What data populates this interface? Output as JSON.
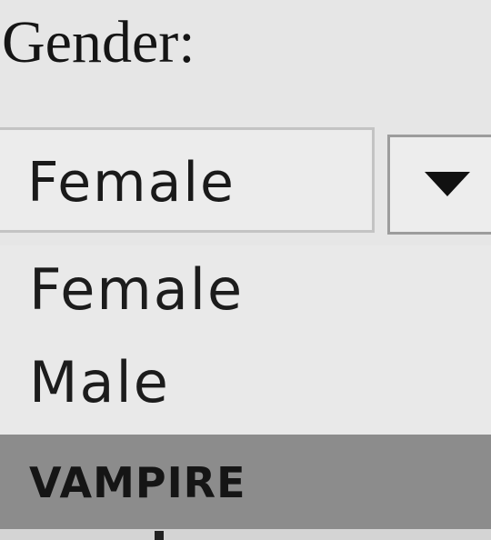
{
  "form": {
    "label": "Gender:",
    "select": {
      "selected_value": "Female",
      "arrow_icon": "triangle-down-icon",
      "options": [
        {
          "label": "Female",
          "highlighted": false
        },
        {
          "label": "Male",
          "highlighted": false
        },
        {
          "label": "VAMPIRE",
          "highlighted": true
        }
      ]
    }
  },
  "colors": {
    "background": "#e6e6e6",
    "highlight": "#8c8c8c",
    "text": "#1a1a1a"
  }
}
